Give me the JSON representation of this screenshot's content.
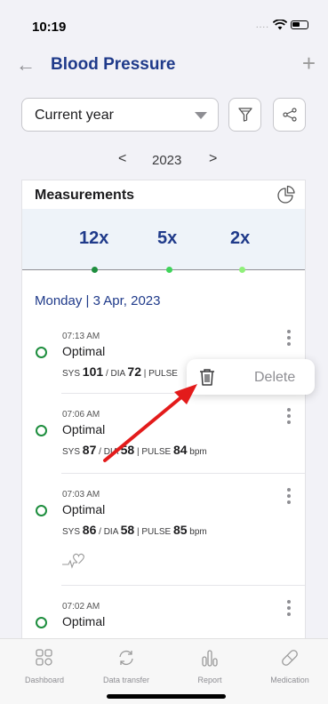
{
  "status_bar": {
    "time": "10:19",
    "signal_dots": "....",
    "wifi_icon": "wifi-icon",
    "battery_icon": "battery-icon"
  },
  "nav": {
    "back_icon": "back-arrow-icon",
    "title": "Blood Pressure",
    "add_icon": "plus-icon"
  },
  "filter": {
    "period_selected": "Current year",
    "filter_icon": "filter-icon",
    "share_icon": "share-icon"
  },
  "year_nav": {
    "prev": "<",
    "year": "2023",
    "next": ">"
  },
  "measurements": {
    "title": "Measurements",
    "chart_icon": "pie-chart-icon",
    "stats": [
      {
        "count": "12x",
        "color": "#1e8e3e"
      },
      {
        "count": "5x",
        "color": "#3fd45a"
      },
      {
        "count": "2x",
        "color": "#8ff07a"
      }
    ]
  },
  "day_header": "Monday | 3 Apr, 2023",
  "entries": [
    {
      "time": "07:13 AM",
      "status": "Optimal",
      "sys_label": "SYS",
      "sys": "101",
      "dia_label": "/ DIA",
      "dia": "72",
      "pulse_label": "| PULSE",
      "pulse": "",
      "pulse_unit": ""
    },
    {
      "time": "07:06 AM",
      "status": "Optimal",
      "sys_label": "SYS",
      "sys": "87",
      "dia_label": "/ DIA",
      "dia": "58",
      "pulse_label": "| PULSE",
      "pulse": "84",
      "pulse_unit": "bpm"
    },
    {
      "time": "07:03 AM",
      "status": "Optimal",
      "sys_label": "SYS",
      "sys": "86",
      "dia_label": "/ DIA",
      "dia": "58",
      "pulse_label": "| PULSE",
      "pulse": "85",
      "pulse_unit": "bpm"
    },
    {
      "time": "07:02 AM",
      "status": "Optimal"
    }
  ],
  "context_menu": {
    "trash_icon": "trash-icon",
    "label": "Delete"
  },
  "tabs": [
    {
      "label": "Dashboard",
      "icon": "dashboard-icon"
    },
    {
      "label": "Data transfer",
      "icon": "sync-icon"
    },
    {
      "label": "Report",
      "icon": "report-icon"
    },
    {
      "label": "Medication",
      "icon": "pill-icon"
    }
  ]
}
